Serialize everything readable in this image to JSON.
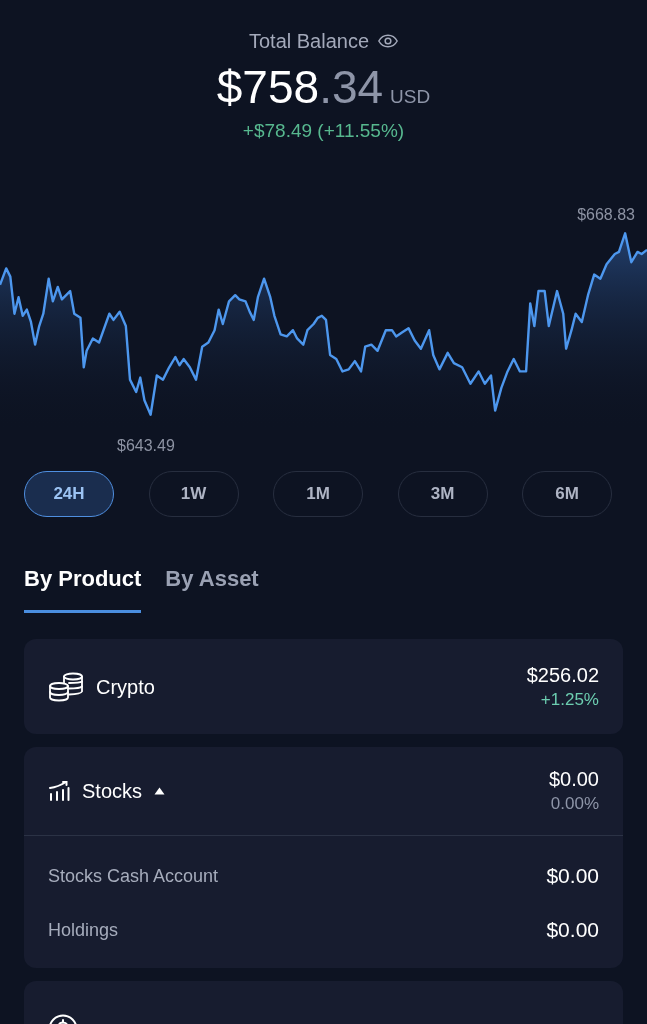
{
  "header": {
    "title": "Total Balance",
    "balance_whole": "$758",
    "balance_fraction": ".34",
    "currency": "USD",
    "change": "+$78.49 (+11.55%)"
  },
  "chart": {
    "high_label": "$668.83",
    "low_label": "$643.49"
  },
  "ranges": [
    {
      "label": "24H",
      "selected": true
    },
    {
      "label": "1W",
      "selected": false
    },
    {
      "label": "1M",
      "selected": false
    },
    {
      "label": "3M",
      "selected": false
    },
    {
      "label": "6M",
      "selected": false
    }
  ],
  "tabs": [
    {
      "label": "By Product",
      "selected": true
    },
    {
      "label": "By Asset",
      "selected": false
    }
  ],
  "products": [
    {
      "kind": "coins",
      "name": "Crypto",
      "value": "$256.02",
      "change": "+1.25%",
      "color": "#6ccdb0"
    },
    {
      "kind": "chart",
      "name": "Stocks",
      "value": "$0.00",
      "change": "0.00%",
      "color": "#8e95a8",
      "expanded": true,
      "rows": [
        {
          "label": "Stocks Cash Account",
          "value": "$0.00"
        },
        {
          "label": "Holdings",
          "value": "$0.00"
        }
      ]
    },
    {
      "kind": "dollar"
    }
  ]
}
